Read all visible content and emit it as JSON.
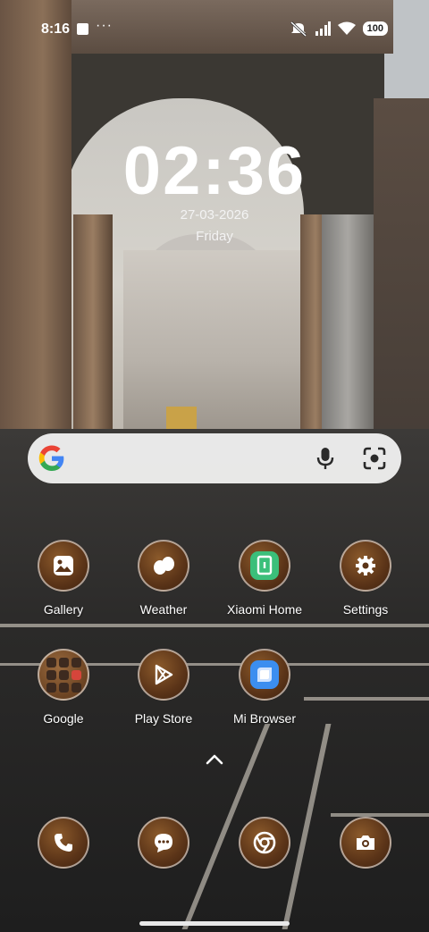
{
  "status_bar": {
    "time": "8:16",
    "overflow": "···",
    "icons": [
      "mute-icon",
      "signal-icon",
      "wifi-icon"
    ],
    "battery": "100"
  },
  "clock": {
    "time": "02:36",
    "date": "27-03-2026",
    "day": "Friday"
  },
  "search": {
    "icons": [
      "google-logo",
      "mic-icon",
      "lens-icon"
    ]
  },
  "apps": [
    {
      "label": "Gallery",
      "icon": "gallery-icon"
    },
    {
      "label": "Weather",
      "icon": "weather-icon"
    },
    {
      "label": "Xiaomi Home",
      "icon": "xiaomi-home-icon"
    },
    {
      "label": "Settings",
      "icon": "gear-icon"
    },
    {
      "label": "Google",
      "icon": "folder-icon"
    },
    {
      "label": "Play Store",
      "icon": "play-store-icon"
    },
    {
      "label": "Mi Browser",
      "icon": "browser-icon"
    }
  ],
  "dock": [
    {
      "icon": "phone-icon"
    },
    {
      "icon": "messages-icon"
    },
    {
      "icon": "chrome-icon"
    },
    {
      "icon": "camera-icon"
    }
  ],
  "colors": {
    "icon_brown": "#6b3f1f",
    "xiaomi_green": "#3bbf7a",
    "browser_blue": "#3b8ef0"
  }
}
